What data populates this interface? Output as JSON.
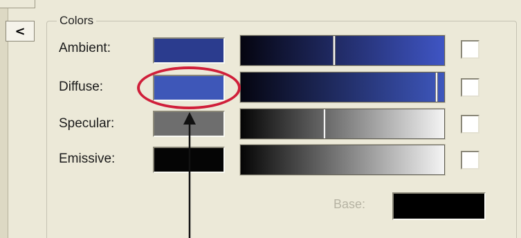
{
  "panel": {
    "collapse_icon": "chevron-left-icon",
    "collapse_glyph": "<",
    "group_title": "Colors",
    "rows": [
      {
        "label": "Ambient:",
        "swatch_color": "#2b3c8e",
        "slider_position": 0.46,
        "slider_from": "#050510",
        "slider_to": "#3f55c4",
        "checked": false
      },
      {
        "label": "Diffuse:",
        "swatch_color": "#3e57b8",
        "slider_position": 0.97,
        "slider_from": "#050510",
        "slider_to": "#3e57bd",
        "checked": false
      },
      {
        "label": "Specular:",
        "swatch_color": "#6e6e6e",
        "slider_position": 0.41,
        "slider_from": "#050505",
        "slider_to": "#f4f4f4",
        "checked": false
      },
      {
        "label": "Emissive:",
        "swatch_color": "#050505",
        "slider_position": null,
        "slider_from": "#050505",
        "slider_to": "#f4f4f4",
        "checked": false
      }
    ],
    "base": {
      "label": "Base:",
      "color": "#000000",
      "enabled": false
    }
  },
  "annotation": {
    "ring_color": "#d01f3a",
    "arrow_color": "#111111",
    "target": "Diffuse:"
  }
}
